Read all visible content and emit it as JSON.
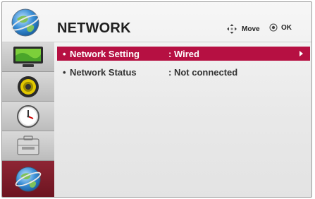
{
  "header": {
    "title": "NETWORK",
    "hint_move": "Move",
    "hint_ok": "OK",
    "icon": "globe-icon"
  },
  "sidebar": {
    "items": [
      {
        "name": "picture",
        "icon": "tv-screen-icon",
        "active": false
      },
      {
        "name": "audio",
        "icon": "speaker-icon",
        "active": false
      },
      {
        "name": "time",
        "icon": "clock-icon",
        "active": false
      },
      {
        "name": "option",
        "icon": "toolbox-icon",
        "active": false
      },
      {
        "name": "network",
        "icon": "globe-icon",
        "active": true
      }
    ]
  },
  "menu": {
    "rows": [
      {
        "bullet": "•",
        "label": "Network Setting",
        "value": ": Wired",
        "selected": true
      },
      {
        "bullet": "•",
        "label": "Network Status",
        "value": ": Not connected",
        "selected": false
      }
    ]
  },
  "colors": {
    "selected_row": "#b61042",
    "active_tab": "#7d1d2a"
  }
}
